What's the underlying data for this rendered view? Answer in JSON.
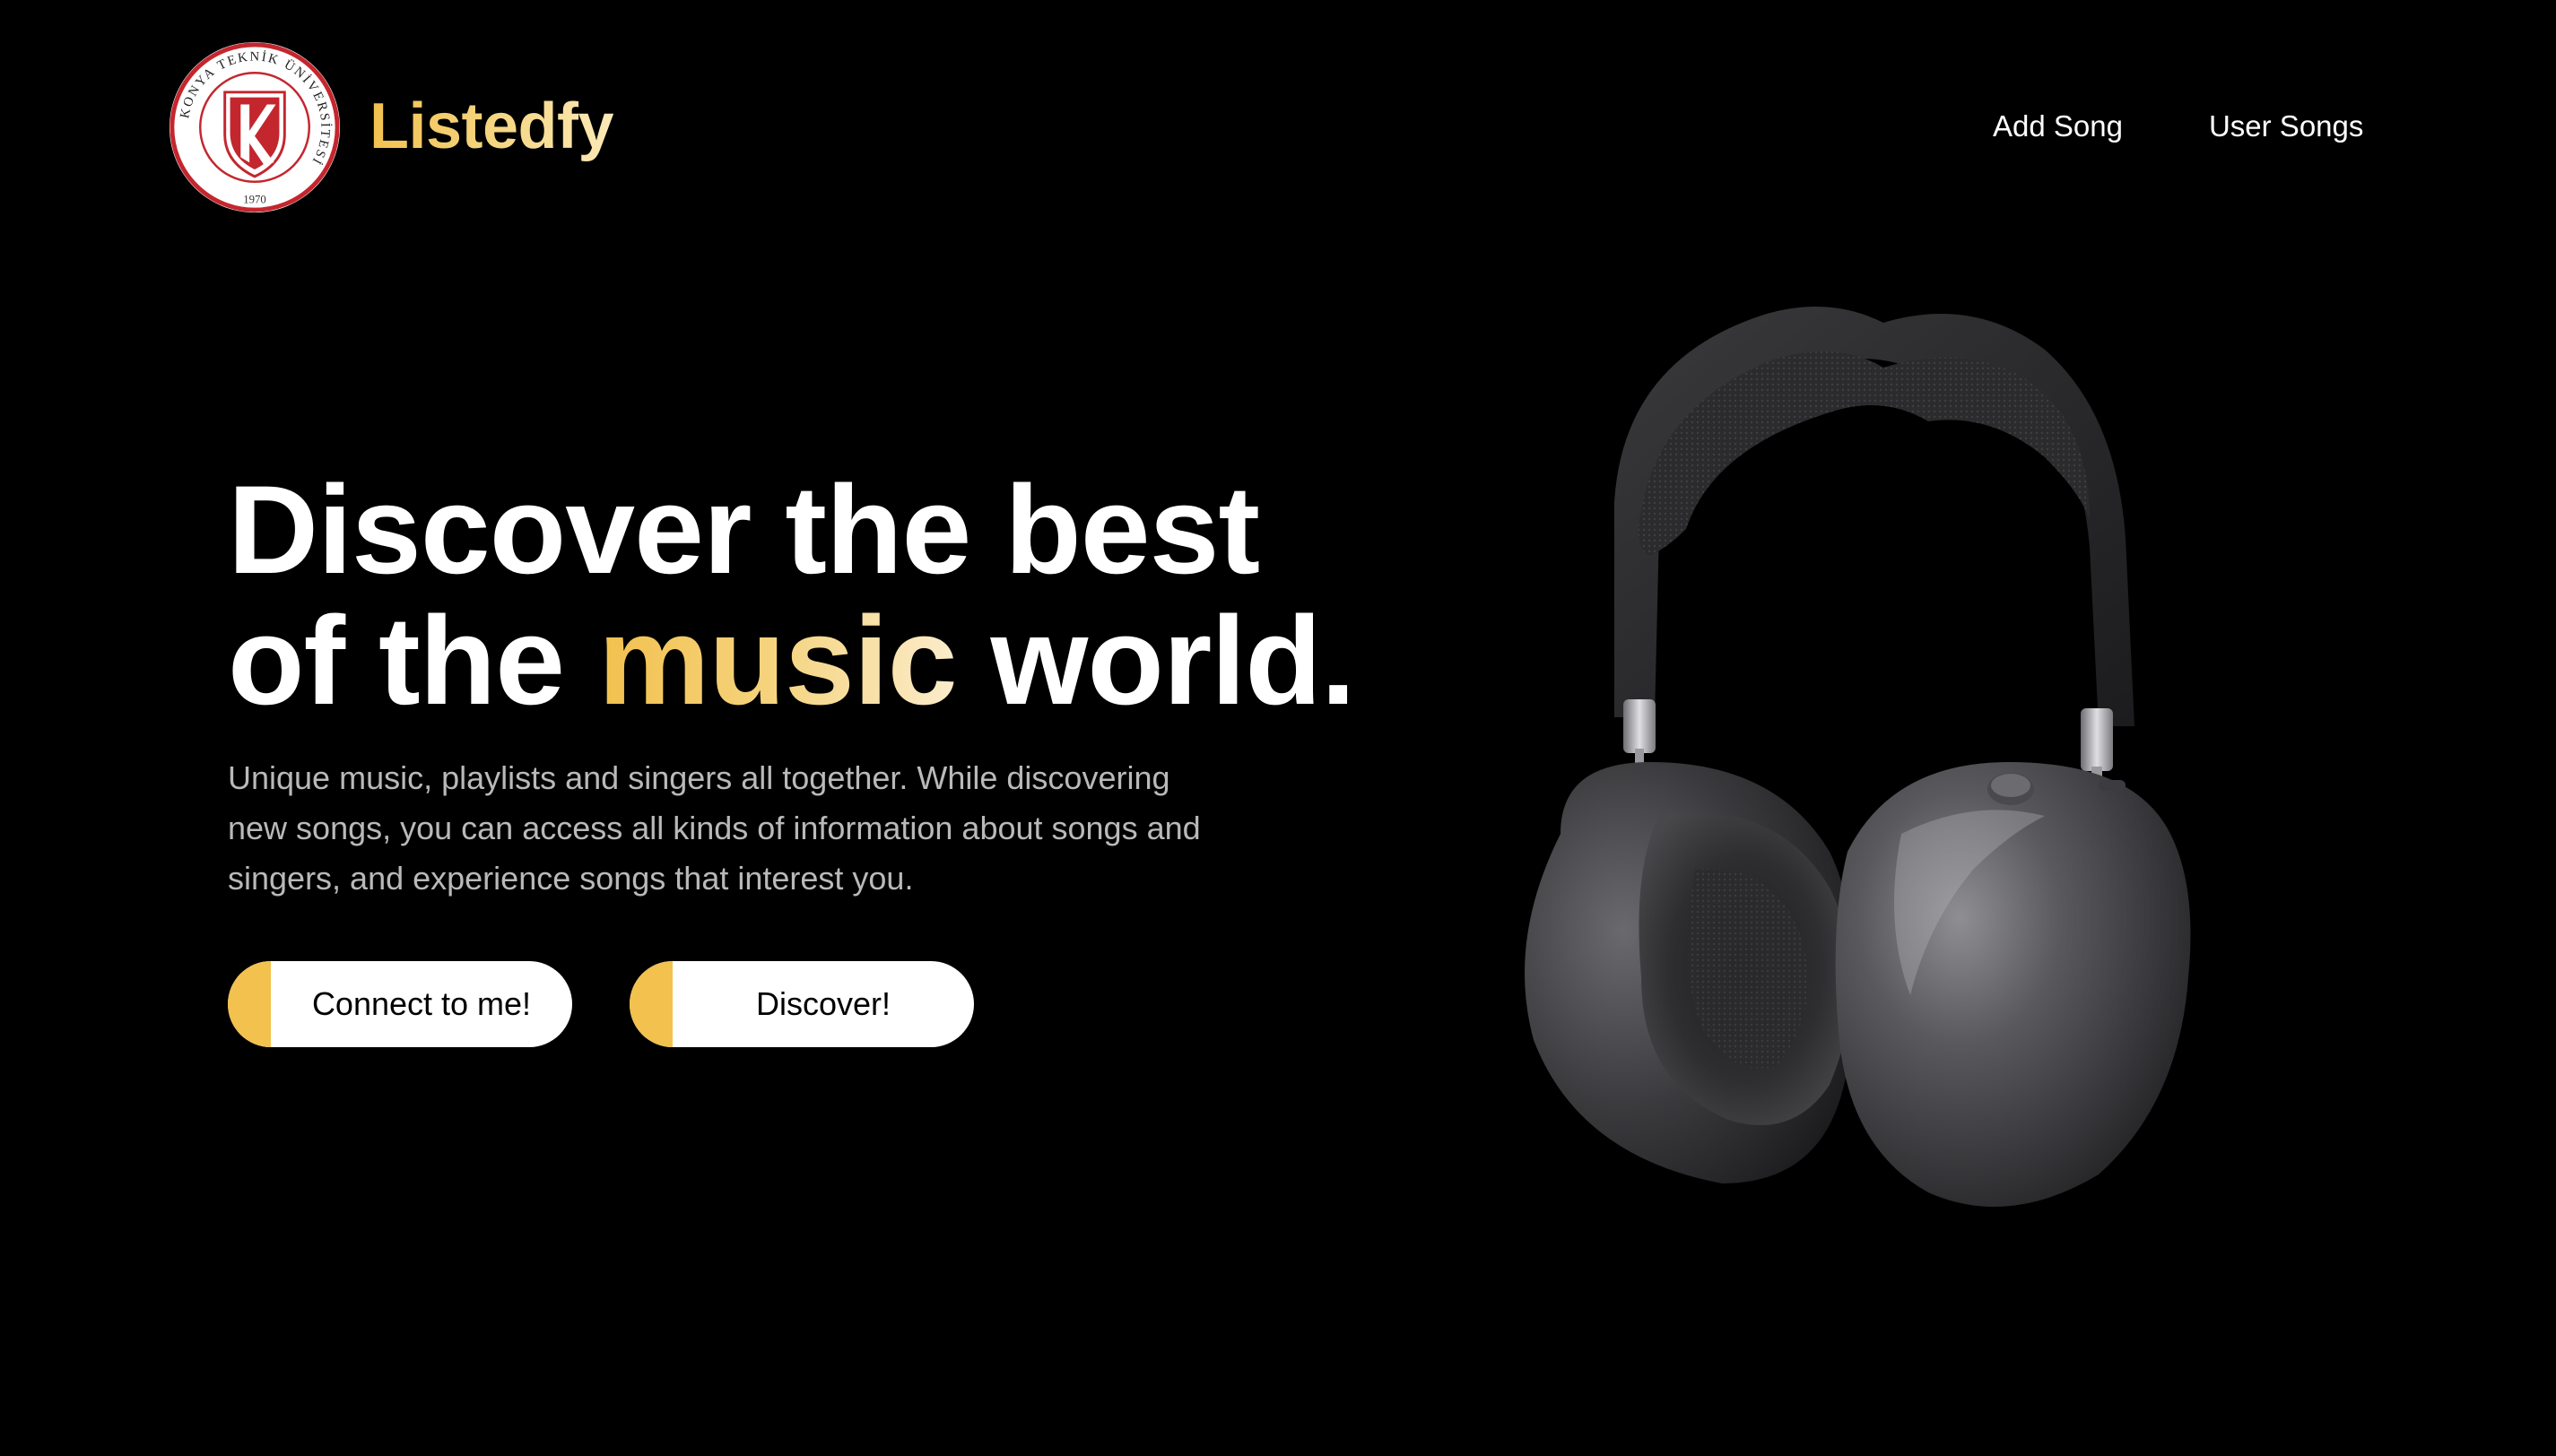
{
  "header": {
    "logo": {
      "icon": "university-seal-icon",
      "seal_text": "KONYA TEKNİK ÜNİVERSİTESİ",
      "year": "1970"
    },
    "brand": "Listedfy",
    "nav": [
      {
        "label": "Add Song"
      },
      {
        "label": "User Songs"
      }
    ]
  },
  "hero": {
    "title_line1": "Discover the best",
    "title_line2_prefix": "of the ",
    "title_line2_accent": "music",
    "title_line2_suffix": " world.",
    "description": "Unique music, playlists and singers all together. While discovering new songs, you can access all kinds of information about songs and singers, and experience songs that interest you.",
    "buttons": [
      {
        "label": "Connect to me!"
      },
      {
        "label": "Discover!"
      }
    ],
    "image": {
      "icon": "headphones-image"
    }
  },
  "colors": {
    "background": "#000000",
    "accent": "#f2c14e",
    "text": "#ffffff",
    "muted_text": "#b9b9b9",
    "button_bg": "#ffffff",
    "seal_red": "#c4262e"
  }
}
